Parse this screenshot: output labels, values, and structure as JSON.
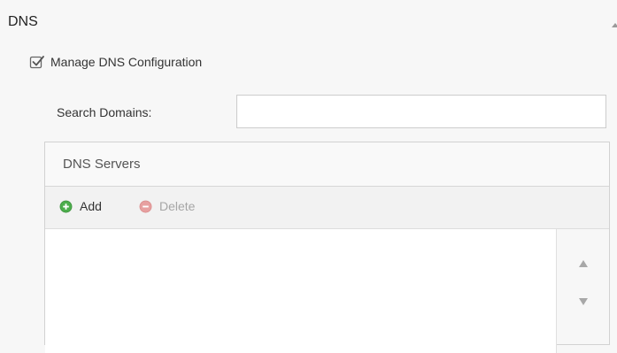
{
  "panel": {
    "title": "DNS",
    "collapse_icon": "chevron-up-icon"
  },
  "manage_dns": {
    "label": "Manage DNS Configuration",
    "checked": true,
    "icon": "checkbox-checked-icon"
  },
  "search_domains": {
    "label": "Search Domains:",
    "value": ""
  },
  "dns_servers": {
    "title": "DNS Servers",
    "toolbar": {
      "add_label": "Add",
      "add_icon": "plus-circle-icon",
      "add_color": "#4cae4c",
      "delete_label": "Delete",
      "delete_icon": "minus-circle-icon",
      "delete_color": "#e7a0a0",
      "delete_enabled": false
    },
    "rows": [],
    "move_up_icon": "arrow-up-icon",
    "move_down_icon": "arrow-down-icon"
  }
}
